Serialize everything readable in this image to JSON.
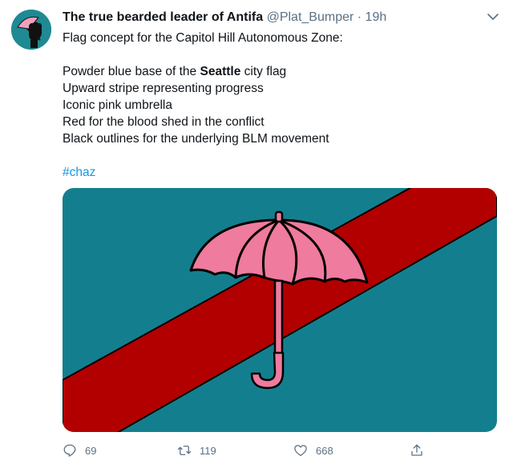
{
  "tweet": {
    "display_name": "The true bearded leader of Antifa",
    "handle": "@Plat_Bumper",
    "separator": "·",
    "time": "19h",
    "lines": [
      "Flag concept for the Capitol Hill Autonomous Zone:",
      "",
      "Powder blue base of the ",
      "Upward stripe representing progress",
      "Iconic pink umbrella",
      "Red for the blood shed in the conflict",
      "Black outlines for the underlying BLM movement"
    ],
    "line3_bold": "Seattle",
    "line3_tail": " city flag",
    "hashtag": "#chaz"
  },
  "actions": {
    "replies": "69",
    "retweets": "119",
    "likes": "668"
  },
  "icons": {
    "avatar": "pink-umbrella-fist-icon",
    "caret": "chevron-down-icon",
    "reply": "reply-icon",
    "retweet": "retweet-icon",
    "like": "heart-icon",
    "share": "share-icon"
  },
  "colors": {
    "flag_blue": "#137f8e",
    "flag_red": "#b20000",
    "umbrella_pink": "#ef7b9e",
    "link": "#1b95e0",
    "muted": "#5b7083"
  }
}
